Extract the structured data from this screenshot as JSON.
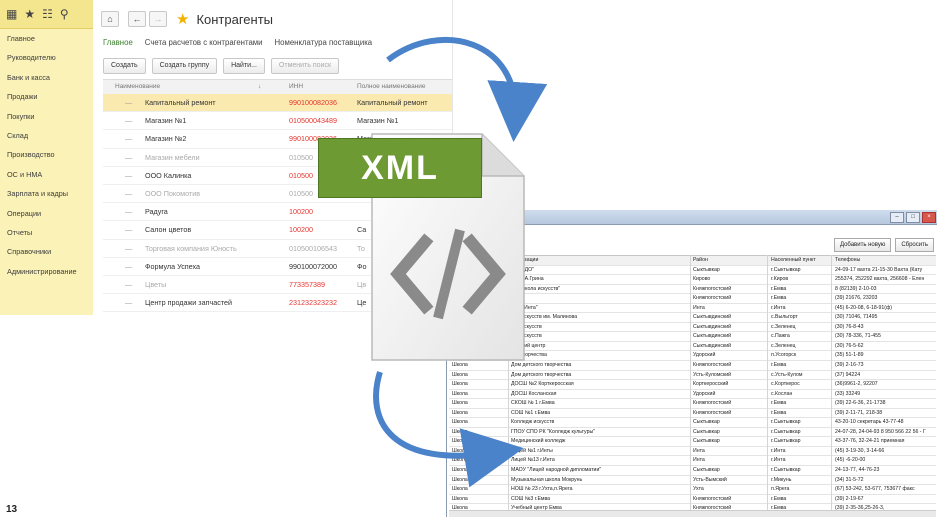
{
  "page_number": "13",
  "onec": {
    "sidebar": {
      "top_icons": [
        "grid-icon",
        "star-icon",
        "history-icon",
        "search-icon"
      ],
      "items": [
        {
          "label": "Главное"
        },
        {
          "label": "Руководителю"
        },
        {
          "label": "Банк и касса"
        },
        {
          "label": "Продажи"
        },
        {
          "label": "Покупки"
        },
        {
          "label": "Склад"
        },
        {
          "label": "Производство"
        },
        {
          "label": "ОС и НМА"
        },
        {
          "label": "Зарплата и кадры"
        },
        {
          "label": "Операции"
        },
        {
          "label": "Отчеты"
        },
        {
          "label": "Справочники"
        },
        {
          "label": "Администрирование"
        }
      ]
    },
    "title": "Контрагенты",
    "tabs": [
      "Главное",
      "Счета расчетов с контрагентами",
      "Номенклатура поставщика"
    ],
    "buttons": {
      "create": "Создать",
      "create_group": "Создать группу",
      "find": "Найти...",
      "cancel_search": "Отменить поиск"
    },
    "columns": {
      "name": "Наименование",
      "inn": "ИНН",
      "full": "Полное наименование"
    },
    "rows": [
      {
        "name": "Капитальный ремонт",
        "inn": "990100082036",
        "full": "Капитальный ремонт"
      },
      {
        "name": "Магазин №1",
        "inn": "010500043489",
        "full": "Магазин №1"
      },
      {
        "name": "Магазин №2",
        "inn": "990100082036",
        "full": "Магазин №2"
      },
      {
        "name": "Магазин мебели",
        "inn": "010500",
        "full": ""
      },
      {
        "name": "ООО Калинка",
        "inn": "010500",
        "full": ""
      },
      {
        "name": "ООО Покомотив",
        "inn": "010500",
        "full": ""
      },
      {
        "name": "Радуга",
        "inn": "100200",
        "full": ""
      },
      {
        "name": "Салон цветов",
        "inn": "100200",
        "full": "Са"
      },
      {
        "name": "Торговая компания Юность",
        "inn": "010500106543",
        "full": "То"
      },
      {
        "name": "Формула Успеха",
        "inn": "990100072000",
        "full": "Фо"
      },
      {
        "name": "Цветы",
        "inn": "773357389",
        "full": "Цв"
      },
      {
        "name": "Центр продажи запчастей",
        "inn": "231232323232",
        "full": "Це"
      }
    ]
  },
  "xml_label": "XML",
  "sheet": {
    "buttons": {
      "add": "Добавить новую",
      "reset": "Сбросить"
    },
    "header": [
      "",
      "рганизации",
      "Район",
      "Населенный пункт",
      "Телефоны"
    ],
    "rows": [
      [
        "",
        "К \"РЦДО\"",
        "Сыктывкар",
        "г.Сыктывкар",
        "24-09-17 вахта 21-15-30 Вахта (Кату"
      ],
      [
        "",
        "мени А.Грина",
        "Кирово",
        "г.Киров",
        "255374, 252292 вахта, 256608 - Елен"
      ],
      [
        "",
        "ная школа искусств\"",
        "Княжпогостский",
        "г.Емва",
        "8 (82139) 2-10-03"
      ],
      [
        "",
        "Ява",
        "Княжпогостский",
        "г.Емва",
        "(39) 21676, 23203"
      ],
      [
        "",
        "ород Инта\"",
        "Инта",
        "г.Инта",
        "(45) 6-20-08, 6-18-91(ф)"
      ],
      [
        "",
        "ола искусств им. Малинова",
        "Сыктывдинский",
        "с.Выльгорт",
        "(30) 71046, 71495"
      ],
      [
        "",
        "ола искусств",
        "Сыктывдинский",
        "с.Зеленец",
        "(30) 76-8-43"
      ],
      [
        "",
        "ола искусств",
        "Сыктывдинский",
        "с.Пажга",
        "(30) 78-336, 71-455"
      ],
      [
        "",
        "рческий центр",
        "Сыктывдинский",
        "с.Зеленец",
        "(30) 76-5-62"
      ],
      [
        "",
        "ого творчества",
        "Удорский",
        "п.Усогорск",
        "(35) 51-1-89"
      ],
      [
        "Школа",
        "Дом детского творчества",
        "Княжпогостский",
        "г.Емва",
        "(39) 2-16-73"
      ],
      [
        "Школа",
        "Дом детского творчества",
        "Усть-Куломский",
        "с.Усть-Кулом",
        "(37) 94224"
      ],
      [
        "Школа",
        "ДОСШ №2 Корткеросская",
        "Корткеросский",
        "с.Корткерос",
        "(36)9961-2, 92207"
      ],
      [
        "Школа",
        "ДОСШ Косланская",
        "Удорский",
        "с.Кослан",
        "(33) 33249"
      ],
      [
        "Школа",
        "СКОШ № 1 г.Емва",
        "Княжпогостский",
        "г.Емва",
        "(39) 22-6-36, 21-1738"
      ],
      [
        "Школа",
        "СОШ №1 г.Емва",
        "Княжпогостский",
        "г.Емва",
        "(39) 2-11-71, 218-38"
      ],
      [
        "Школа",
        "Колледж искусств",
        "Сыктывкар",
        "г.Сыктывкар",
        "43-20-10 секретарь 43-77-48"
      ],
      [
        "Школа",
        "ГПОУ СПО РК \"Колледж культуры\"",
        "Сыктывкар",
        "г.Сыктывкар",
        "24-07-28, 24-04-93 8 950 566 22 56 - Г"
      ],
      [
        "Школа",
        "Медицинский колледж",
        "Сыктывкар",
        "г.Сыктывкар",
        "43-37-76, 32-24-21 приемная"
      ],
      [
        "Школа",
        "Лицей №1 г.Инты",
        "Инта",
        "г.Инта",
        "(45) 3-19-30, 3-14-66"
      ],
      [
        "Школа",
        "Лицей №13 г.Инта",
        "Инта",
        "г.Инта",
        "(45) -6-20-00"
      ],
      [
        "Школа",
        "МАОУ \"Лицей народной дипломатии\"",
        "Сыктывкар",
        "г.Сыктывкар",
        "24-13-77, 44-76-23"
      ],
      [
        "Школа",
        "Музыкальная школа Мокрунь",
        "Усть-Вымский",
        "г.Микунь",
        "(34) 31-5-72"
      ],
      [
        "Школа",
        "НОШ № 23 г.Ухта,п.Ярега",
        "Ухта",
        "п.Ярега",
        "(67) 53-242, 53-677, 753677 факс"
      ],
      [
        "Школа",
        "СОШ №3 г.Емва",
        "Княжпогостский",
        "г.Емва",
        "(39) 2-19-67"
      ],
      [
        "Школа",
        "Учебный центр Емва",
        "Княжпогостский",
        "г.Емва",
        "(39) 2-35-36,25-26-3,"
      ],
      [
        "Школа",
        "НОШ Вомынская",
        "Корткеросский",
        "с.Вомынчуг",
        ""
      ]
    ]
  },
  "colors": {
    "sidebar_bg": "#fbf2b8",
    "selected_row": "#fbeab0",
    "xml_green": "#6e9a34",
    "arrow_blue": "#4a83c9",
    "green_tab": "#3a7f2a"
  }
}
